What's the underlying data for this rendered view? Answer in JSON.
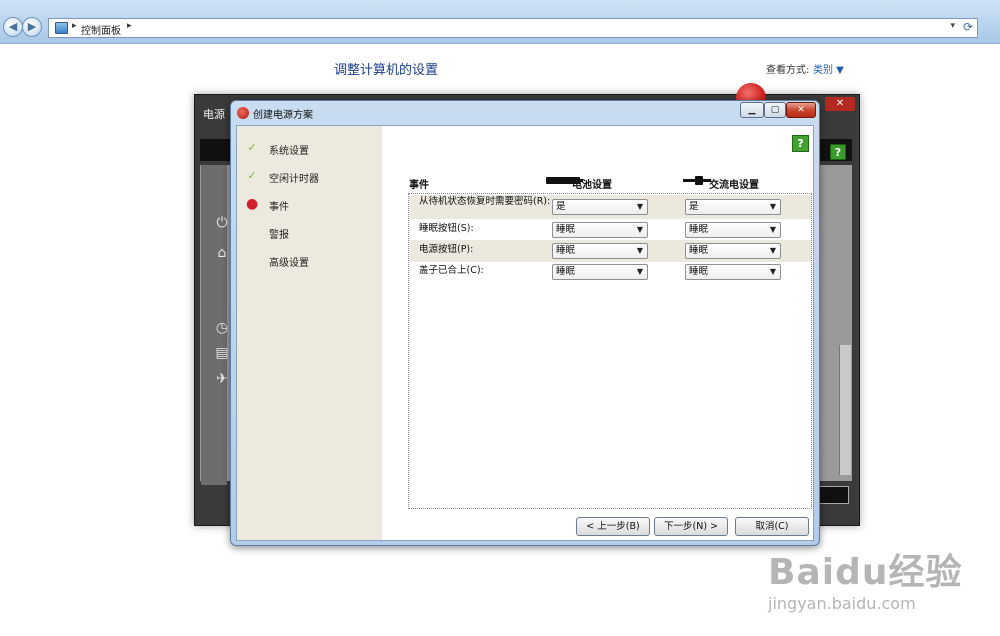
{
  "explorer": {
    "breadcrumb": "控制面板"
  },
  "control_panel": {
    "title": "调整计算机的设置",
    "view_by_label": "查看方式:",
    "view_by_value": "类别 ▼"
  },
  "background_window": {
    "title_fragment": "电源"
  },
  "dialog": {
    "title": "创建电源方案",
    "nav": [
      {
        "label": "系统设置",
        "state": "done"
      },
      {
        "label": "空闲计时器",
        "state": "done"
      },
      {
        "label": "事件",
        "state": "current"
      },
      {
        "label": "警报",
        "state": "pending"
      },
      {
        "label": "高级设置",
        "state": "pending"
      }
    ],
    "table": {
      "col_event": "事件",
      "col_battery": "电池设置",
      "col_ac": "交流电设置",
      "rows": [
        {
          "label": "从待机状态恢复时需要密码(R):",
          "battery": "是",
          "ac": "是"
        },
        {
          "label": "睡眠按钮(S):",
          "battery": "睡眠",
          "ac": "睡眠"
        },
        {
          "label": "电源按钮(P):",
          "battery": "睡眠",
          "ac": "睡眠"
        },
        {
          "label": "盖子已合上(C):",
          "battery": "睡眠",
          "ac": "睡眠"
        }
      ]
    },
    "buttons": {
      "back": "< 上一步(B)",
      "next": "下一步(N) >",
      "cancel": "取消(C)"
    },
    "help": "?"
  },
  "watermark": {
    "logo": "Baidu经验",
    "url": "jingyan.baidu.com"
  },
  "colors": {
    "accent_title": "#1a3e8c",
    "check": "#7cb52f",
    "current_dot": "#d4202a",
    "help_green": "#43a12f"
  }
}
